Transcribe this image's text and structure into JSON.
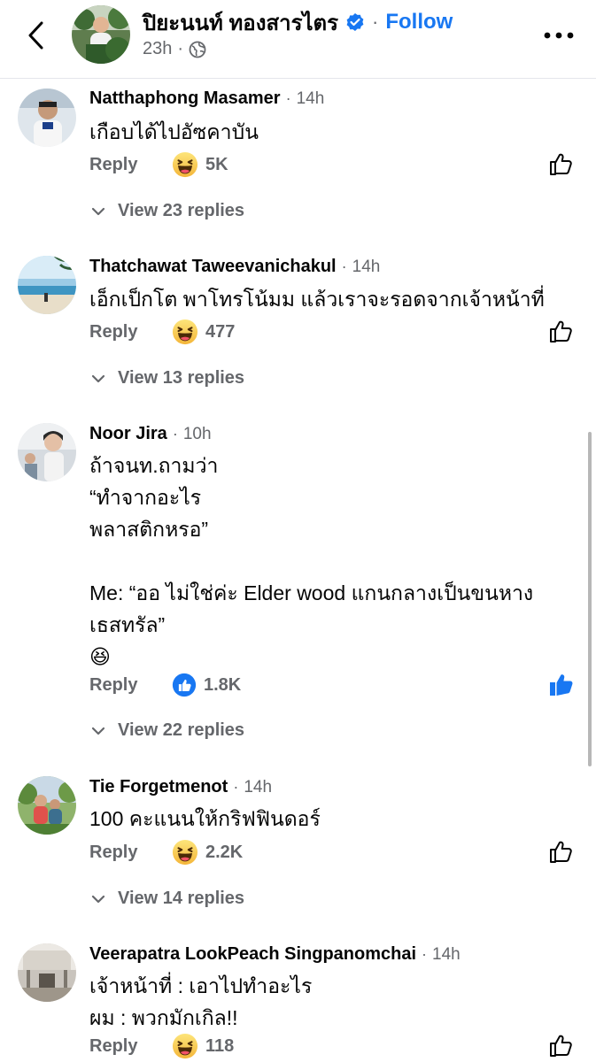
{
  "header": {
    "page_name": "ปิยะนนท์ ทองสารไตร",
    "separator": "·",
    "follow_label": "Follow",
    "time": "23h",
    "meta_separator": "·",
    "audience_icon": "globe-icon",
    "back_icon": "chevron-left-icon",
    "more_icon": "more-dots-icon",
    "verified_icon": "verified-badge-icon"
  },
  "comments": [
    {
      "author": "Natthaphong Masamer",
      "time": "14h",
      "lines": [
        "เกือบได้ไปอัซคาบัน"
      ],
      "reply_label": "Reply",
      "reaction_icon": "haha-icon",
      "reaction_count": "5K",
      "liked": false,
      "view_replies": "View 23 replies"
    },
    {
      "author": "Thatchawat Taweevanichakul",
      "time": "14h",
      "lines": [
        "เอ็กเป็กโต พาโทรโน้มม แล้วเราจะรอดจากเจ้าหน้าที่"
      ],
      "reply_label": "Reply",
      "reaction_icon": "haha-icon",
      "reaction_count": "477",
      "liked": false,
      "view_replies": "View 13 replies"
    },
    {
      "author": "Noor Jira",
      "time": "10h",
      "lines": [
        "ถ้าจนท.ถามว่า",
        "“ทำจากอะไร",
        "พลาสติกหรอ”",
        "",
        "Me: “ออ ไม่ใช่ค่ะ Elder wood แกนกลางเป็นขนหาง",
        "เธสทรัล”",
        "😆"
      ],
      "reply_label": "Reply",
      "reaction_icon": "like-reaction-icon",
      "reaction_count": "1.8K",
      "liked": true,
      "view_replies": "View 22 replies"
    },
    {
      "author": "Tie Forgetmenot",
      "time": "14h",
      "lines": [
        "100 คะแนนให้กริฟฟินดอร์"
      ],
      "reply_label": "Reply",
      "reaction_icon": "haha-icon",
      "reaction_count": "2.2K",
      "liked": false,
      "view_replies": "View 14 replies"
    },
    {
      "author": "Veerapatra LookPeach Singpanomchai",
      "time": "14h",
      "lines": [
        "เจ้าหน้าที่ : เอาไปทำอะไร",
        "ผม : พวกมักเกิล!!"
      ],
      "reply_label": "Reply",
      "reaction_icon": "haha-icon",
      "reaction_count": "118",
      "liked": false,
      "view_replies": ""
    }
  ],
  "colors": {
    "accent": "#1877f2",
    "secondary_text": "#65676b",
    "primary_text": "#050505",
    "haha_yellow": "#f7c34f"
  }
}
